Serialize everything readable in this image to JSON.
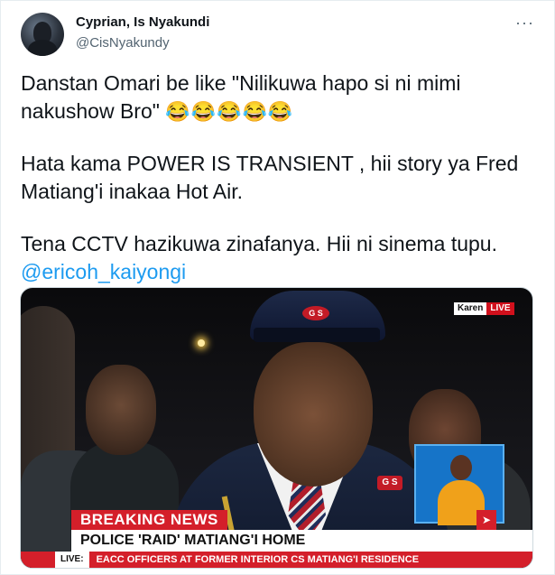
{
  "tweet": {
    "author_name": "Cyprian, Is Nyakundi",
    "author_handle": "@CisNyakundy",
    "more_icon": "more-horizontal-icon",
    "paragraph1_text": "Danstan Omari be like \"Nilikuwa hapo si ni mimi nakushow Bro\" ",
    "paragraph1_emoji": "😂😂😂😂😂",
    "paragraph2_text": "Hata kama POWER IS TRANSIENT , hii story ya  Fred Matiang'i  inakaa Hot Air.",
    "paragraph3_text": "Tena CCTV hazikuwa zinafanya. Hii ni sinema tupu.",
    "mention": "@ericoh_kaiyongi"
  },
  "media": {
    "live_location": "Karen",
    "live_tag": "LIVE",
    "breaking_label": "BREAKING NEWS",
    "headline": "POLICE 'RAID' MATIANG'I HOME",
    "ticker_label": "LIVE:",
    "ticker_text": "EACC OFFICERS AT FORMER INTERIOR CS MATIANG'I RESIDENCE",
    "cap_logo": "G S",
    "badge_logo": "G S"
  },
  "colors": {
    "mention": "#1d9bf0",
    "breaking_red": "#d41f2a",
    "text_primary": "#0f1419",
    "text_secondary": "#536471"
  }
}
